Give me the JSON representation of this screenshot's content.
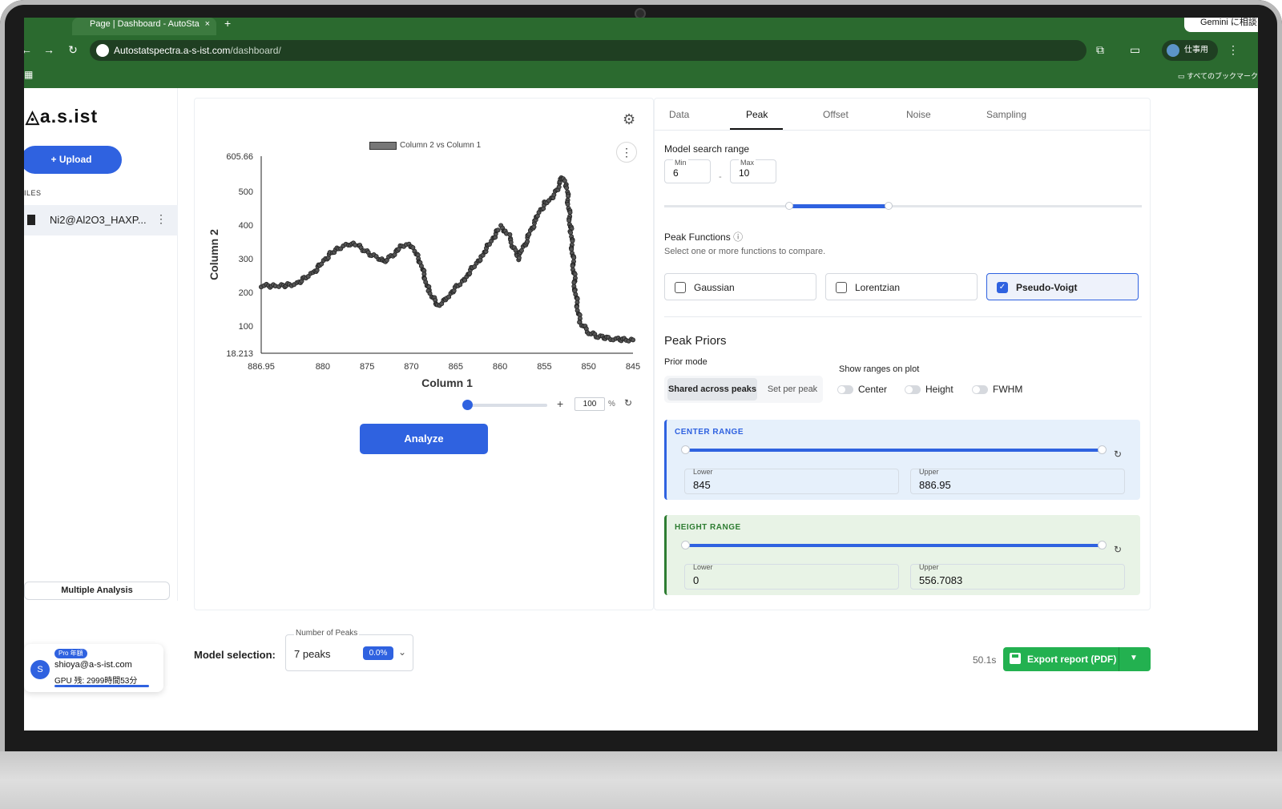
{
  "browser": {
    "tab_title": "Page | Dashboard - AutoSta",
    "tab_close": "×",
    "new_tab": "+",
    "gemini": "Gemini に相談",
    "url_host": "Autostatspectra.a-s-ist.com",
    "url_path": "/dashboard/",
    "profile": "仕事用",
    "bookmarks": "すべてのブックマーク"
  },
  "sidebar": {
    "logo": "a.s.ist",
    "upload_label": "+ Upload",
    "files_label": "ILES",
    "file_name": "Ni2@Al2O3_HAXP...",
    "multiple_analysis": "Multiple Analysis",
    "user": {
      "avatar": "S",
      "plan": "Pro 年額",
      "email": "shioya@a-s-ist.com",
      "gpu": "GPU 残: 2999時間53分"
    }
  },
  "plot": {
    "legend": "Column 2 vs Column 1",
    "zoom_value": "100",
    "zoom_unit": "%",
    "analyze": "Analyze"
  },
  "chart_data": {
    "type": "scatter",
    "xlabel": "Column 1",
    "ylabel": "Column 2",
    "series_name": "Column 2 vs Column 1",
    "x_reversed": true,
    "xlim": [
      886.95,
      845
    ],
    "ylim": [
      18.213,
      605.66
    ],
    "x_ticks": [
      "886.95",
      "880",
      "875",
      "870",
      "865",
      "860",
      "855",
      "850",
      "845"
    ],
    "y_ticks": [
      "605.66",
      "500",
      "400",
      "300",
      "200",
      "100",
      "18.213"
    ],
    "x": [
      886.95,
      885,
      883,
      881,
      879,
      877,
      876,
      875,
      873,
      871,
      870,
      869,
      868,
      867,
      866,
      864,
      862,
      860,
      859,
      858,
      857,
      856,
      855,
      854,
      853,
      852.5,
      852,
      851.5,
      851,
      850,
      849,
      847,
      845
    ],
    "y": [
      220,
      218,
      225,
      260,
      320,
      345,
      340,
      320,
      290,
      340,
      340,
      290,
      200,
      160,
      185,
      240,
      310,
      395,
      370,
      300,
      355,
      415,
      465,
      480,
      545,
      520,
      380,
      200,
      110,
      80,
      68,
      60,
      58
    ]
  },
  "right": {
    "tabs": [
      "Data",
      "Peak",
      "Offset",
      "Noise",
      "Sampling"
    ],
    "model_search_range": "Model search range",
    "min_label": "Min",
    "min_value": "6",
    "max_label": "Max",
    "max_value": "10",
    "range_dash": "-",
    "range_slider": {
      "lo": 6,
      "hi": 10
    },
    "peak_functions": "Peak Functions",
    "peak_functions_hint": "Select one or more functions to compare.",
    "functions": [
      {
        "label": "Gaussian",
        "checked": false
      },
      {
        "label": "Lorentzian",
        "checked": false
      },
      {
        "label": "Pseudo-Voigt",
        "checked": true
      }
    ],
    "peak_priors": "Peak Priors",
    "prior_mode": "Prior mode",
    "shared": "Shared across peaks",
    "per_peak": "Set per peak",
    "show_ranges": "Show ranges on plot",
    "toggles": [
      "Center",
      "Height",
      "FWHM"
    ],
    "center_range": {
      "title": "CENTER RANGE",
      "lower_label": "Lower",
      "lower": "845",
      "upper_label": "Upper",
      "upper": "886.95"
    },
    "height_range": {
      "title": "HEIGHT RANGE",
      "lower_label": "Lower",
      "lower": "0",
      "upper_label": "Upper",
      "upper": "556.7083"
    }
  },
  "bottom": {
    "model_selection": "Model selection:",
    "num_peaks_label": "Number of Peaks",
    "num_peaks_value": "7 peaks",
    "pct": "0.0%",
    "elapsed": "50.1s",
    "export": "Export report (PDF)"
  }
}
